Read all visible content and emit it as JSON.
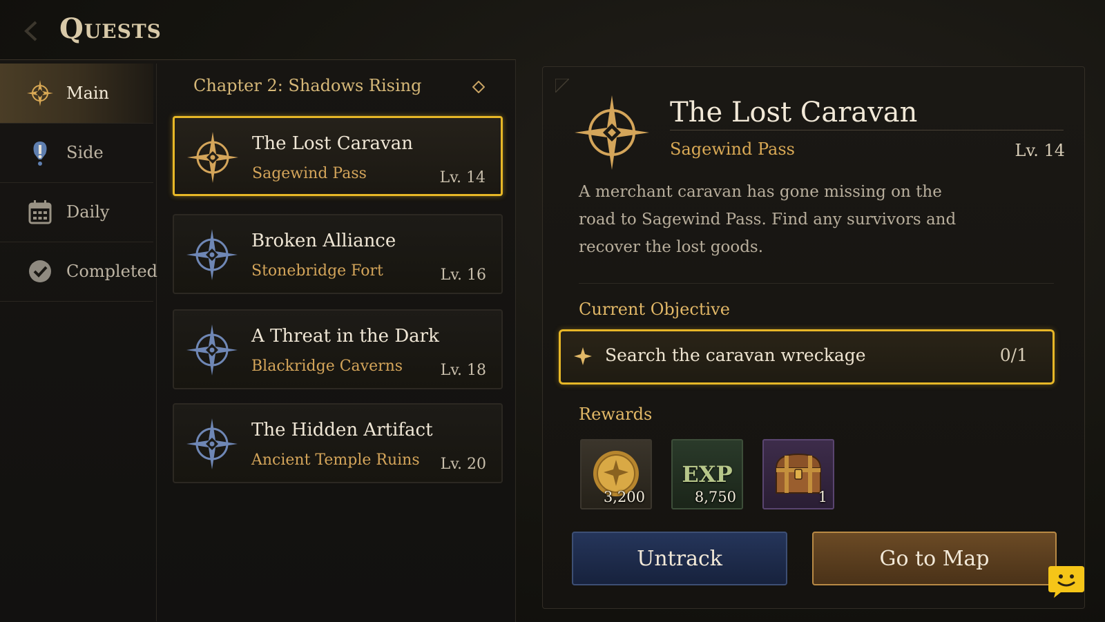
{
  "header": {
    "title": "Quests"
  },
  "sidebar": {
    "items": [
      {
        "label": "Main",
        "icon": "compass-icon",
        "active": true
      },
      {
        "label": "Side",
        "icon": "exclamation-icon",
        "active": false
      },
      {
        "label": "Daily",
        "icon": "calendar-icon",
        "active": false
      },
      {
        "label": "Completed",
        "icon": "checkmark-icon",
        "active": false
      }
    ]
  },
  "quest_list": {
    "chapter": "Chapter 2: Shadows Rising",
    "quests": [
      {
        "name": "The Lost Caravan",
        "location": "Sagewind Pass",
        "level": "Lv. 14",
        "selected": true
      },
      {
        "name": "Broken Alliance",
        "location": "Stonebridge Fort",
        "level": "Lv. 16",
        "selected": false
      },
      {
        "name": "A Threat in the Dark",
        "location": "Blackridge Caverns",
        "level": "Lv. 18",
        "selected": false
      },
      {
        "name": "The Hidden Artifact",
        "location": "Ancient Temple Ruins",
        "level": "Lv. 20",
        "selected": false
      }
    ]
  },
  "detail": {
    "title": "The Lost Caravan",
    "location": "Sagewind Pass",
    "level": "Lv. 14",
    "description": "A merchant caravan has gone missing on the road to Sagewind Pass. Find any survivors and recover the lost goods.",
    "objective_label": "Current Objective",
    "objective": {
      "text": "Search the caravan wreckage",
      "progress": "0/1"
    },
    "rewards_label": "Rewards",
    "rewards": [
      {
        "type": "gold",
        "icon": "gold-coin-icon",
        "count": "3,200"
      },
      {
        "type": "exp",
        "icon": "exp-icon",
        "label": "EXP",
        "count": "8,750"
      },
      {
        "type": "chest",
        "icon": "treasure-chest-icon",
        "count": "1"
      }
    ],
    "buttons": {
      "untrack": "Untrack",
      "go_to_map": "Go to Map"
    }
  },
  "colors": {
    "accent_gold": "#e7b727",
    "location_text": "#d4a55a",
    "untrack_button": "#25355a",
    "map_button": "#6b4a25",
    "chat_fab": "#f5c518"
  }
}
